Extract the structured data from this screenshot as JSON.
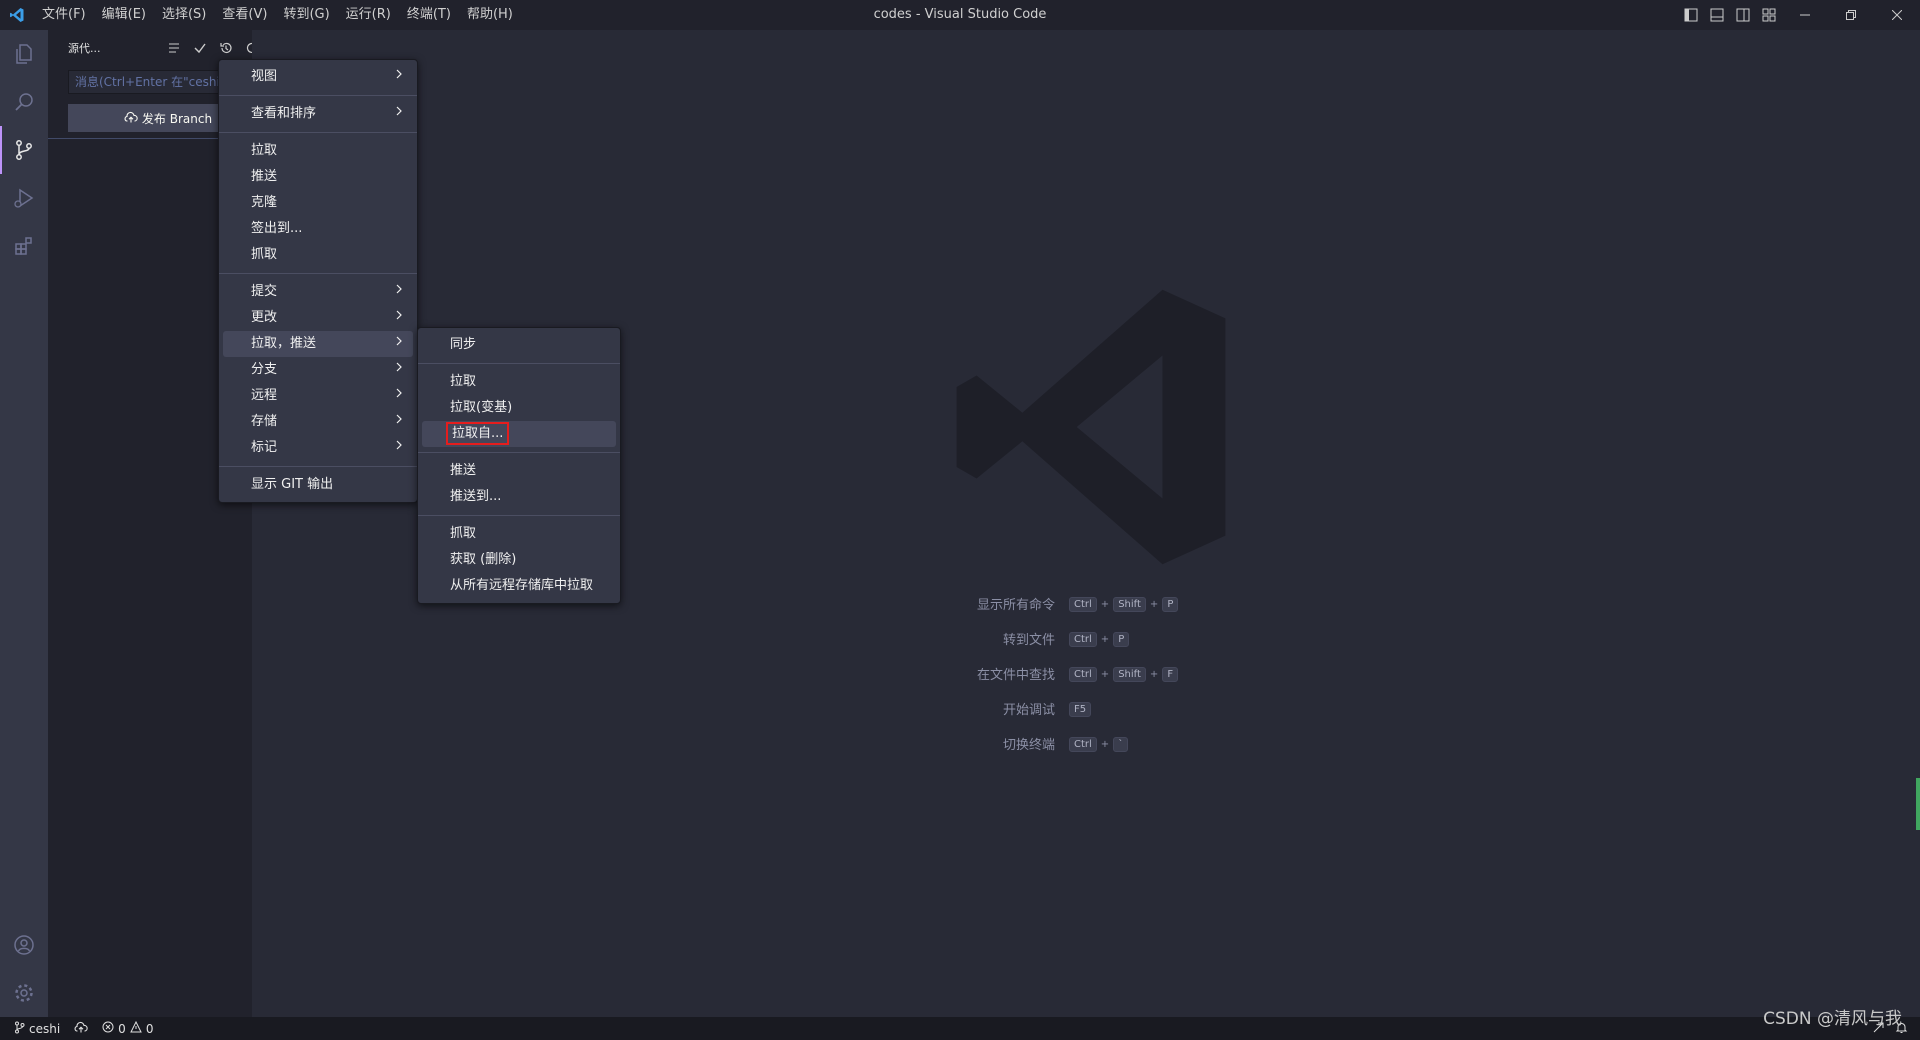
{
  "titlebar": {
    "menus": [
      "文件(F)",
      "编辑(E)",
      "选择(S)",
      "查看(V)",
      "转到(G)",
      "运行(R)",
      "终端(T)",
      "帮助(H)"
    ],
    "title": "codes - Visual Studio Code"
  },
  "sidebar": {
    "header": "源代...",
    "commit_placeholder": "消息(Ctrl+Enter 在\"ceshi\"提交)",
    "publish_label": "发布 Branch"
  },
  "main_menu": {
    "items": [
      {
        "label": "视图",
        "submenu": true
      },
      {
        "sep": true
      },
      {
        "label": "查看和排序",
        "submenu": true
      },
      {
        "sep": true
      },
      {
        "label": "拉取"
      },
      {
        "label": "推送"
      },
      {
        "label": "克隆"
      },
      {
        "label": "签出到..."
      },
      {
        "label": "抓取"
      },
      {
        "sep": true
      },
      {
        "label": "提交",
        "submenu": true
      },
      {
        "label": "更改",
        "submenu": true
      },
      {
        "label": "拉取，推送",
        "submenu": true,
        "highlighted": true
      },
      {
        "label": "分支",
        "submenu": true
      },
      {
        "label": "远程",
        "submenu": true
      },
      {
        "label": "存储",
        "submenu": true
      },
      {
        "label": "标记",
        "submenu": true
      },
      {
        "sep": true
      },
      {
        "label": "显示 GIT 输出"
      }
    ]
  },
  "sub_menu": {
    "items": [
      {
        "label": "同步"
      },
      {
        "sep": true
      },
      {
        "label": "拉取"
      },
      {
        "label": "拉取(变基)"
      },
      {
        "label": "拉取自...",
        "highlighted": true,
        "boxed": true
      },
      {
        "sep": true
      },
      {
        "label": "推送"
      },
      {
        "label": "推送到..."
      },
      {
        "sep": true
      },
      {
        "label": "抓取"
      },
      {
        "label": "获取 (删除)"
      },
      {
        "label": "从所有远程存储库中拉取"
      }
    ]
  },
  "shortcuts": [
    {
      "label": "显示所有命令",
      "keys": [
        "Ctrl",
        "Shift",
        "P"
      ]
    },
    {
      "label": "转到文件",
      "keys": [
        "Ctrl",
        "P"
      ]
    },
    {
      "label": "在文件中查找",
      "keys": [
        "Ctrl",
        "Shift",
        "F"
      ]
    },
    {
      "label": "开始调试",
      "keys": [
        "F5"
      ]
    },
    {
      "label": "切换终端",
      "keys": [
        "Ctrl",
        "`"
      ]
    }
  ],
  "statusbar": {
    "branch": "ceshi",
    "errors": "0",
    "warnings": "0"
  },
  "watermark": "CSDN @清风与我",
  "colors": {
    "accent": "#bd93f9",
    "highlight_box": "#e51d1d"
  }
}
